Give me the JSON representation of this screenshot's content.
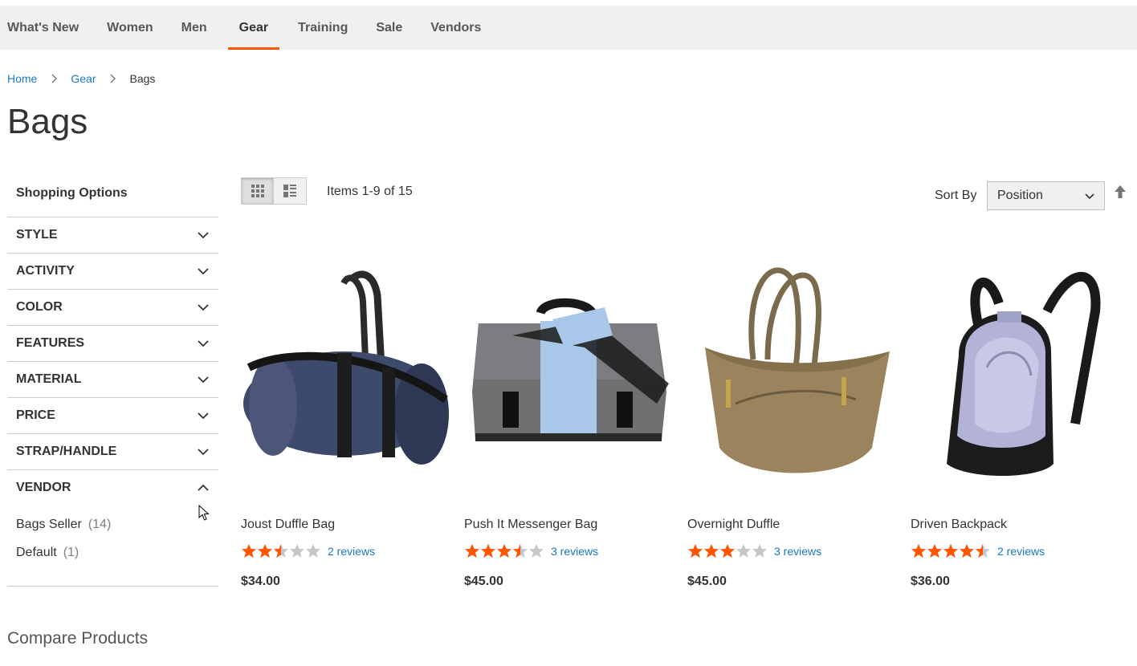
{
  "nav": {
    "items": [
      "What's New",
      "Women",
      "Men",
      "Gear",
      "Training",
      "Sale",
      "Vendors"
    ],
    "active": "Gear",
    "accent": "#ff5501"
  },
  "breadcrumb": [
    "Home",
    "Gear",
    "Bags"
  ],
  "page_title": "Bags",
  "sidebar": {
    "title": "Shopping Options",
    "filters": [
      "STYLE",
      "ACTIVITY",
      "COLOR",
      "FEATURES",
      "MATERIAL",
      "PRICE",
      "STRAP/HANDLE",
      "VENDOR"
    ],
    "vendor_options": [
      {
        "label": "Bags Seller",
        "count": "(14)"
      },
      {
        "label": "Default",
        "count": "(1)"
      }
    ]
  },
  "compare_title": "Compare Products",
  "toolbar": {
    "amount": "Items 1-9 of 15",
    "sort_label": "Sort By",
    "sort_value": "Position",
    "view_modes": [
      "grid-icon",
      "list-icon"
    ]
  },
  "products": [
    {
      "name": "Joust Duffle Bag",
      "rating": 2.5,
      "reviews": "2 reviews",
      "price": "$34.00",
      "icon": "duffle-bag-image"
    },
    {
      "name": "Push It Messenger Bag",
      "rating": 3.5,
      "reviews": "3 reviews",
      "price": "$45.00",
      "icon": "messenger-bag-image"
    },
    {
      "name": "Overnight Duffle",
      "rating": 3,
      "reviews": "3 reviews",
      "price": "$45.00",
      "icon": "tote-duffle-image"
    },
    {
      "name": "Driven Backpack",
      "rating": 4.5,
      "reviews": "2 reviews",
      "price": "$36.00",
      "icon": "backpack-image"
    }
  ],
  "colors": {
    "link": "#1979c3",
    "star": "#ff5501",
    "star_empty": "#c7c7c7"
  }
}
